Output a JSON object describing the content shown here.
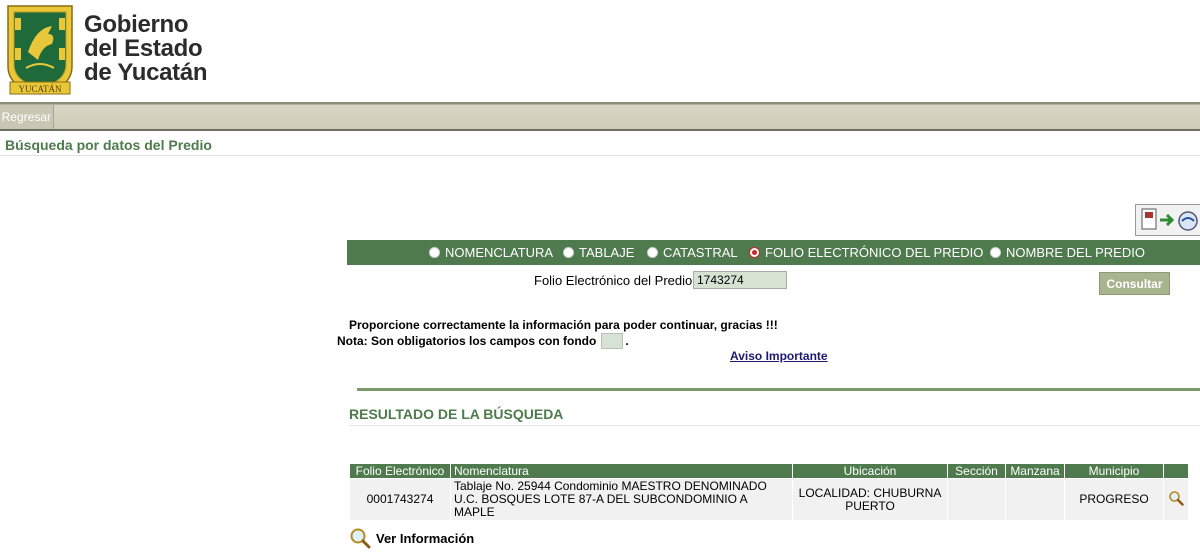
{
  "header": {
    "logo_text": "YUCATÁN",
    "title_lines": [
      "Gobierno",
      "del Estado",
      "de Yucatán"
    ]
  },
  "nav": {
    "back_label": "Regresar"
  },
  "page_title": "Búsqueda por datos del Predio",
  "search": {
    "options": [
      {
        "label": "NOMENCLATURA",
        "selected": false
      },
      {
        "label": "TABLAJE",
        "selected": false
      },
      {
        "label": "CATASTRAL",
        "selected": false
      },
      {
        "label": "FOLIO ELECTRÓNICO DEL PREDIO",
        "selected": true
      },
      {
        "label": "NOMBRE DEL PREDIO",
        "selected": false
      }
    ],
    "folio_label": "Folio Electrónico del Predio:",
    "folio_value": "1743274",
    "submit_label": "Consultar"
  },
  "messages": {
    "line1": "Proporcione correctamente la información para poder continuar, gracias !!!",
    "line2": "Nota: Son obligatorios los campos con fondo",
    "line2_end": ".",
    "aviso": "Aviso Importante"
  },
  "results": {
    "title": "RESULTADO DE LA BÚSQUEDA",
    "columns": [
      "Folio Electrónico",
      "Nomenclatura",
      "Ubicación",
      "Sección",
      "Manzana",
      "Municipio"
    ],
    "rows": [
      {
        "folio": "0001743274",
        "nomenclatura": "Tablaje No. 25944 Condominio MAESTRO DENOMINADO U.C. BOSQUES LOTE 87-A DEL SUBCONDOMINIO A MAPLE",
        "ubicacion": "LOCALIDAD: CHUBURNA PUERTO",
        "seccion": "",
        "manzana": "",
        "municipio": "PROGRESO"
      }
    ],
    "ver_info_label": "Ver Información"
  },
  "colors": {
    "green_bar": "#4e7a4e",
    "title_green": "#4e7b4c",
    "input_bg": "#d6e3d2"
  },
  "icons": [
    "state-seal-logo",
    "export-icon",
    "magnifier-icon"
  ]
}
